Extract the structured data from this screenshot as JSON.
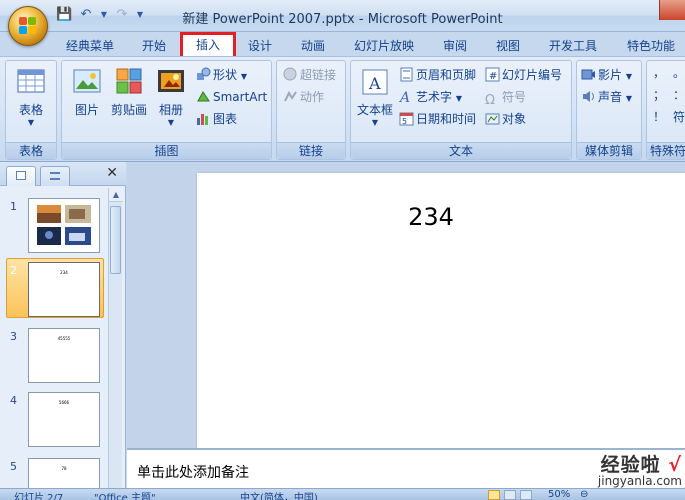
{
  "window": {
    "title": "新建 PowerPoint 2007.pptx - Microsoft PowerPoint"
  },
  "quick_access": {
    "items": [
      "save-icon",
      "undo-icon",
      "redo-icon",
      "customize-icon"
    ]
  },
  "ribbon_tabs": [
    {
      "label": "经典菜单"
    },
    {
      "label": "开始"
    },
    {
      "label": "插入",
      "active": true
    },
    {
      "label": "设计"
    },
    {
      "label": "动画"
    },
    {
      "label": "幻灯片放映"
    },
    {
      "label": "审阅"
    },
    {
      "label": "视图"
    },
    {
      "label": "开发工具"
    },
    {
      "label": "特色功能"
    }
  ],
  "ribbon": {
    "groups": {
      "table": {
        "label": "表格",
        "buttons": {
          "table": "表格"
        }
      },
      "illustrations": {
        "label": "插图",
        "buttons": {
          "picture": "图片",
          "clipart": "剪贴画",
          "album": "相册",
          "shapes": "形状",
          "smartart": "SmartArt",
          "chart": "图表"
        }
      },
      "links": {
        "label": "链接",
        "buttons": {
          "hyperlink": "超链接",
          "action": "动作"
        }
      },
      "text": {
        "label": "文本",
        "buttons": {
          "textbox": "文本框",
          "header_footer": "页眉和页脚",
          "wordart": "艺术字",
          "datetime": "日期和时间",
          "slide_number": "幻灯片编号",
          "symbol": "符号",
          "object": "对象"
        }
      },
      "media": {
        "label": "媒体剪辑",
        "buttons": {
          "movie": "影片",
          "sound": "声音"
        }
      },
      "special": {
        "label": "特殊符",
        "symbols": [
          "，",
          "。",
          "；",
          "：",
          "！",
          "符"
        ]
      }
    }
  },
  "slides_panel": {
    "slides": [
      {
        "number": "1",
        "text": ""
      },
      {
        "number": "2",
        "text": "234",
        "selected": true
      },
      {
        "number": "3",
        "text": "45555"
      },
      {
        "number": "4",
        "text": "5666"
      },
      {
        "number": "5",
        "text": "78"
      }
    ]
  },
  "main_slide": {
    "text": "234"
  },
  "notes": {
    "placeholder": "单击此处添加备注"
  },
  "statusbar": {
    "slide_info": "幻灯片 2/7",
    "theme": "\"Office 主题\"",
    "language": "中文(简体，中国)",
    "zoom": "50%"
  },
  "watermark": {
    "line1": "经验啦",
    "check": "√",
    "line2": "jingyanla.com"
  },
  "colors": {
    "active_tab_border": "#e31e24",
    "ribbon_bg": "#d4e3f5",
    "selected_slide": "#fbc35a"
  }
}
